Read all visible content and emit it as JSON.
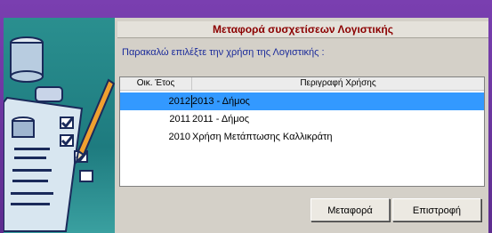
{
  "dialog": {
    "title": "Μεταφορά συσχετίσεων Λογιστικής",
    "prompt": "Παρακαλώ επιλέξτε την χρήση της Λογιστικής :"
  },
  "list": {
    "columns": [
      "Οικ. Έτος",
      "Περιγραφή Χρήσης"
    ],
    "rows": [
      {
        "year": "2012",
        "description": "2013 - Δήμος",
        "selected": true
      },
      {
        "year": "2011",
        "description": "2011 - Δήμος",
        "selected": false
      },
      {
        "year": "2010",
        "description": "Χρήση Μετάπτωσης Καλλικράτη",
        "selected": false
      }
    ]
  },
  "buttons": {
    "transfer": "Μεταφορά",
    "return": "Επιστροφή"
  },
  "icons": {
    "illustration": "clipboard-checklist-pencil-icon"
  },
  "colors": {
    "title_text": "#8b0000",
    "prompt_text": "#1a2a9a",
    "selection": "#3399ff"
  }
}
